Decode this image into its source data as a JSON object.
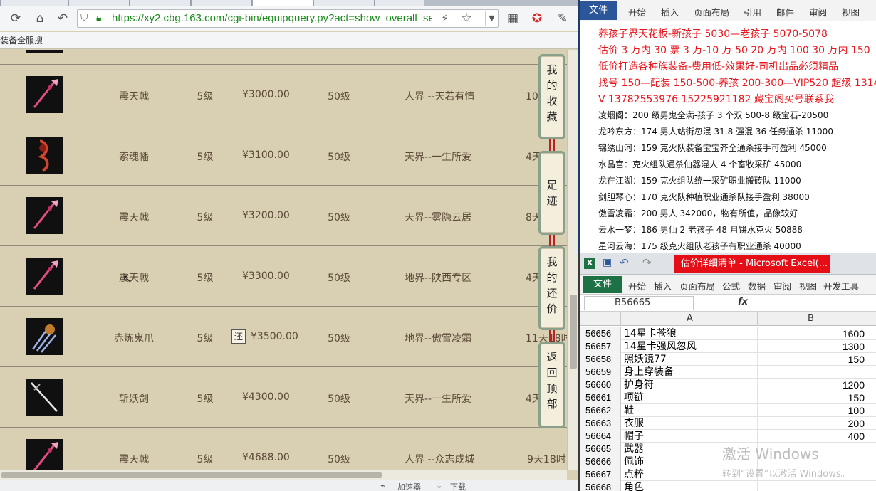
{
  "browser": {
    "url": "https://xy2.cbg.163.com/cgi-bin/equipquery.py?act=show_overall_se",
    "bookmark_text": "装备全服搜",
    "status": {
      "accelerator": "加速器",
      "download": "下载"
    }
  },
  "listing": {
    "rows": [
      {
        "name": "震天戟",
        "level": "5级",
        "price": "¥3000.00",
        "req_level": "50级",
        "server": "人界 --天若有情",
        "time": "10天",
        "tag": "",
        "icon": "pink-spear"
      },
      {
        "name": "索魂幡",
        "level": "5级",
        "price": "¥3100.00",
        "req_level": "50级",
        "server": "天界--一生所爱",
        "time": "4天",
        "tag": "",
        "icon": "red-banner"
      },
      {
        "name": "震天戟",
        "level": "5级",
        "price": "¥3200.00",
        "req_level": "50级",
        "server": "天界--雾隐云居",
        "time": "8天",
        "tag": "",
        "icon": "pink-spear"
      },
      {
        "name": "震天戟",
        "level": "5级",
        "price": "¥3300.00",
        "req_level": "50级",
        "server": "地界--陕西专区",
        "time": "4天",
        "tag": "",
        "icon": "pink-spear"
      },
      {
        "name": "赤炼鬼爪",
        "level": "5级",
        "price": "¥3500.00",
        "req_level": "50级",
        "server": "地界--傲雪凌霜",
        "time": "11天18时",
        "tag": "还",
        "icon": "claw"
      },
      {
        "name": "斩妖剑",
        "level": "5级",
        "price": "¥4300.00",
        "req_level": "50级",
        "server": "天界--一生所爱",
        "time": "4天",
        "tag": "",
        "icon": "sword"
      },
      {
        "name": "震天戟",
        "level": "5级",
        "price": "¥4688.00",
        "req_level": "50级",
        "server": "人界 --众志成城",
        "time": "9天18时",
        "tag": "",
        "icon": "pink-spear"
      }
    ]
  },
  "side_panel": {
    "favorites": "我的收藏",
    "footprints": "足迹",
    "bargain": "我的还价",
    "back_to_top": "返回顶部"
  },
  "word": {
    "tabs": [
      "文件",
      "开始",
      "插入",
      "页面布局",
      "引用",
      "邮件",
      "审阅",
      "视图"
    ],
    "red_lines": [
      "养孩子界天花板-新孩子 5030—老孩子 5070-5078",
      "估价 3 万内 30 票   3 万-10 万 50  20 万内 100  30 万内 150",
      "低价打造各种族装备-费用低-效果好-司机出品必须精品",
      "找号 150—配装 150-500-养孩 200-300—VIP520 超级 1314",
      "V 13782553976     15225921182   藏宝阁买号联系我"
    ],
    "black_lines": [
      "凌烟阁：200 级男鬼全满-孩子 3 个双 500-8 级宝石-20500",
      "龙吟东方：174 男人站街忽混 31.8 强混 36 任务通杀 11000",
      "锦绣山河：159 克火队装备宝宝齐全通杀接手可盈利 45000",
      "水晶宫：克火组队通杀仙器混人 4 个畜牧采矿 45000",
      "龙在江湖：159 克火组队统一采矿职业搬砖队 11000",
      "剑胆琴心：170 克火队种植职业通杀队接手盈利 38000",
      "傲雪凌霜：200 男人 342000，物有所值，品像较好",
      "云水一梦：186 男仙 2 老孩子 48 月饼水克火 50888",
      "星河云海：175 级克火组队老孩子有职业通杀 40000"
    ]
  },
  "excel": {
    "title": "估价详细清单 - Microsoft Excel(...",
    "tabs": [
      "文件",
      "开始",
      "插入",
      "页面布局",
      "公式",
      "数据",
      "审阅",
      "视图",
      "开发工具"
    ],
    "namebox": "B56665",
    "fx": "fx",
    "col_a": "A",
    "col_b": "B",
    "rows": [
      {
        "n": "56656",
        "a": "14星卡苍狼",
        "b": "1600"
      },
      {
        "n": "56657",
        "a": "14星卡强风忽风",
        "b": "1300"
      },
      {
        "n": "56658",
        "a": "照妖镜77",
        "b": "150"
      },
      {
        "n": "56659",
        "a": "身上穿装备",
        "b": ""
      },
      {
        "n": "56660",
        "a": "护身符",
        "b": "1200"
      },
      {
        "n": "56661",
        "a": "项链",
        "b": "150"
      },
      {
        "n": "56662",
        "a": "鞋",
        "b": "100"
      },
      {
        "n": "56663",
        "a": "衣服",
        "b": "200"
      },
      {
        "n": "56664",
        "a": "帽子",
        "b": "400"
      },
      {
        "n": "56665",
        "a": "武器",
        "b": ""
      },
      {
        "n": "56666",
        "a": "佩饰",
        "b": ""
      },
      {
        "n": "56667",
        "a": "点粹",
        "b": ""
      },
      {
        "n": "56668",
        "a": "角色",
        "b": ""
      }
    ],
    "watermark_title": "激活 Windows",
    "watermark_sub": "转到“设置”以激活 Windows。"
  },
  "colors": {
    "page_bg": "#d9cfb3",
    "row_text": "#5a4a36",
    "word_red": "#e8161c",
    "excel_green": "#1e7145",
    "word_blue": "#2b579a"
  }
}
